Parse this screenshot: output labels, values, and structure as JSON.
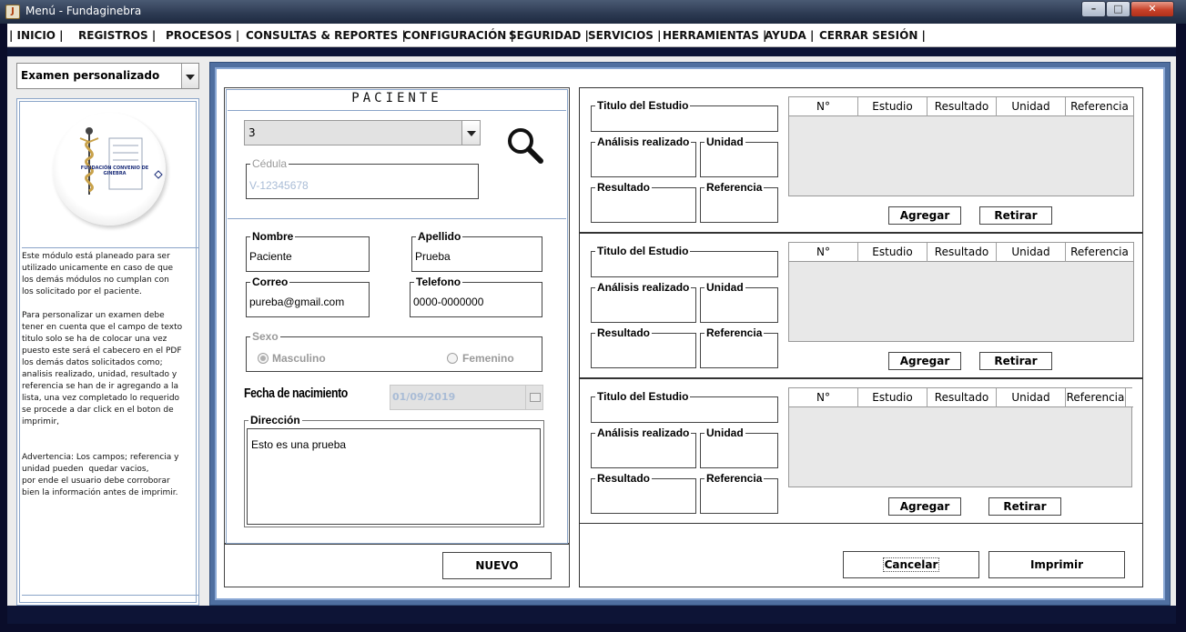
{
  "window": {
    "title": "Menú - Fundaginebra",
    "app_icon": "java-icon"
  },
  "menu": [
    "| INICIO  |",
    "REGISTROS  |",
    "PROCESOS  |",
    "CONSULTAS & REPORTES  |",
    "CONFIGURACIÓN  |",
    "SEGURIDAD  |",
    "SERVICIOS  |",
    "HERRAMIENTAS  |",
    "AYUDA  |",
    "CERRAR SESIÓN  |"
  ],
  "sidebar": {
    "exam_type": "Examen personalizado",
    "logo_text": "FUNDACIÓN CONVENIO DE GINEBRA",
    "description": "Este módulo está planeado para ser\nutilizado unicamente en caso de que\nlos demás módulos no cumplan con\nlos solicitado por el paciente.\n\nPara personalizar un examen debe\ntener en cuenta que el campo de texto\ntitulo solo se ha de colocar una vez\npuesto este será el cabecero en el PDF\nlos demás datos solicitados como;\nanalisis realizado, unidad, resultado y\nreferencia se han de ir agregando a la\nlista, una vez completado lo requerido\nse procede a dar click en el boton de\nimprimir,\n\n\nAdvertencia: Los campos; referencia y\nunidad pueden  quedar vacios,\npor ende el usuario debe corroborar\nbien la información antes de imprimir."
  },
  "patient": {
    "section_title": "PACIENTE",
    "selector_value": "3",
    "cedula_label": "Cédula",
    "cedula_value": "V-12345678",
    "nombre_label": "Nombre",
    "nombre_value": "Paciente",
    "apellido_label": "Apellido",
    "apellido_value": "Prueba",
    "correo_label": "Correo",
    "correo_value": "pureba@gmail.com",
    "telefono_label": "Telefono",
    "telefono_value": "0000-0000000",
    "sexo_label": "Sexo",
    "sexo_options": [
      "Masculino",
      "Femenino"
    ],
    "sexo_selected": "Masculino",
    "fecha_label": "Fecha de nacimiento",
    "fecha_value": "01/09/2019",
    "direccion_label": "Dirección",
    "direccion_value": "Esto es una prueba",
    "nuevo_label": "NUEVO"
  },
  "study_fields": {
    "titulo": "Titulo del Estudio",
    "analisis": "Análisis realizado",
    "unidad": "Unidad",
    "resultado": "Resultado",
    "referencia": "Referencia",
    "agregar": "Agregar",
    "retirar": "Retirar"
  },
  "study_blocks": [
    {
      "columns": [
        "N°",
        "Estudio",
        "Resultado",
        "Unidad",
        "Referencia"
      ]
    },
    {
      "columns": [
        "N°",
        "Estudio",
        "Resultado",
        "Unidad",
        "Referencia"
      ]
    },
    {
      "columns": [
        "N°",
        "Estudio",
        "Resultado",
        "Unidad",
        "Referencia"
      ]
    }
  ],
  "actions": {
    "cancel": "Cancelar",
    "print": "Imprimir"
  }
}
